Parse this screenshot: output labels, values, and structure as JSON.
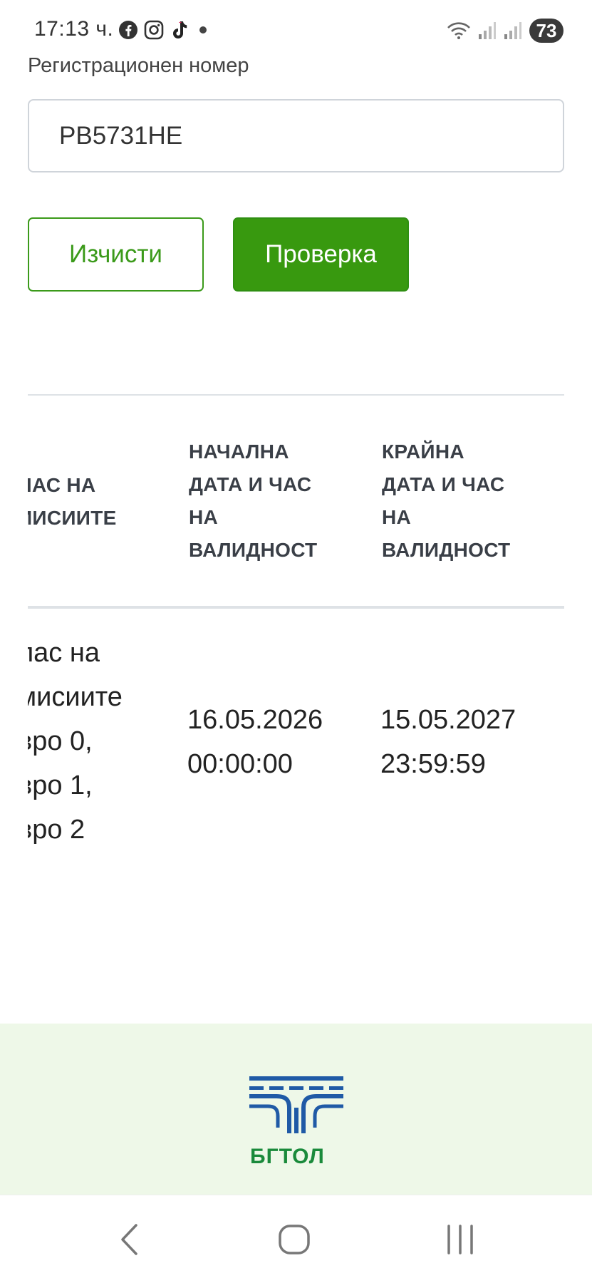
{
  "status_bar": {
    "time": "17:13 ч.",
    "app_icons": [
      "facebook-icon",
      "instagram-icon",
      "tiktok-icon",
      "dot-icon"
    ],
    "battery": "73"
  },
  "form": {
    "label": "Регистрационен номер",
    "registration_value": "PB5731HE",
    "clear_label": "Изчисти",
    "check_label": "Проверка",
    "accent_color": "#38990f"
  },
  "table": {
    "headers": [
      [
        "ЛАС НА",
        "ИИСИИТЕ"
      ],
      [
        "НАЧАЛНА",
        "ДАТА И ЧАС",
        "НА",
        "ВАЛИДНОСТ"
      ],
      [
        "КРАЙНА",
        "ДАТА И ЧАС",
        "НА",
        "ВАЛИДНОСТ"
      ]
    ],
    "row": {
      "col1": [
        "лас на",
        "мисиите",
        "вро 0,",
        "вро 1,",
        "вро 2"
      ],
      "start": [
        "16.05.2026",
        "00:00:00"
      ],
      "end": [
        "15.05.2027",
        "23:59:59"
      ]
    }
  },
  "footer": {
    "logo_text": "БГТОЛ",
    "background": "#eef8e8"
  },
  "nav": {
    "icons": [
      "back-icon",
      "home-icon",
      "recent-apps-icon"
    ]
  }
}
